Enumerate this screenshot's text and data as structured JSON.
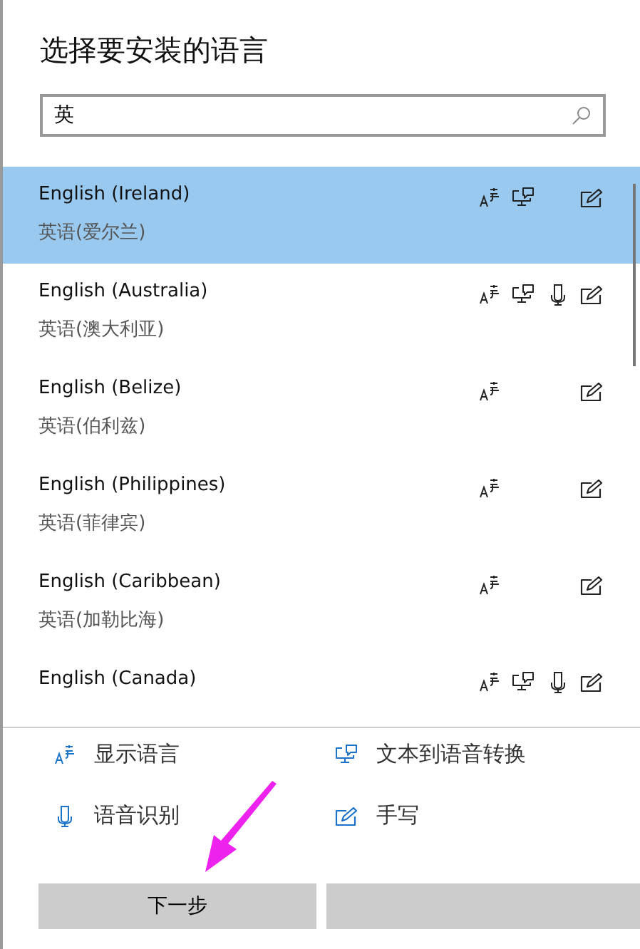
{
  "title": "选择要安装的语言",
  "search": {
    "value": "英"
  },
  "languages": [
    {
      "name": "English (Ireland)",
      "native": "英语(爱尔兰)",
      "selected": true,
      "display": true,
      "tts": true,
      "speech": false,
      "handwriting": true
    },
    {
      "name": "English (Australia)",
      "native": "英语(澳大利亚)",
      "selected": false,
      "display": true,
      "tts": true,
      "speech": true,
      "handwriting": true
    },
    {
      "name": "English (Belize)",
      "native": "英语(伯利兹)",
      "selected": false,
      "display": true,
      "tts": false,
      "speech": false,
      "handwriting": true
    },
    {
      "name": "English (Philippines)",
      "native": "英语(菲律宾)",
      "selected": false,
      "display": true,
      "tts": false,
      "speech": false,
      "handwriting": true
    },
    {
      "name": "English (Caribbean)",
      "native": "英语(加勒比海)",
      "selected": false,
      "display": true,
      "tts": false,
      "speech": false,
      "handwriting": true
    },
    {
      "name": "English (Canada)",
      "selected": false,
      "display": true,
      "tts": true,
      "speech": true,
      "handwriting": true
    }
  ],
  "legend": [
    {
      "kind": "display",
      "label": "显示语言"
    },
    {
      "kind": "tts",
      "label": "文本到语音转换"
    },
    {
      "kind": "speech",
      "label": "语音识别"
    },
    {
      "kind": "handwriting",
      "label": "手写"
    }
  ],
  "buttons": [
    {
      "kind": "next",
      "label": "下一步"
    },
    {
      "kind": "blank"
    }
  ]
}
